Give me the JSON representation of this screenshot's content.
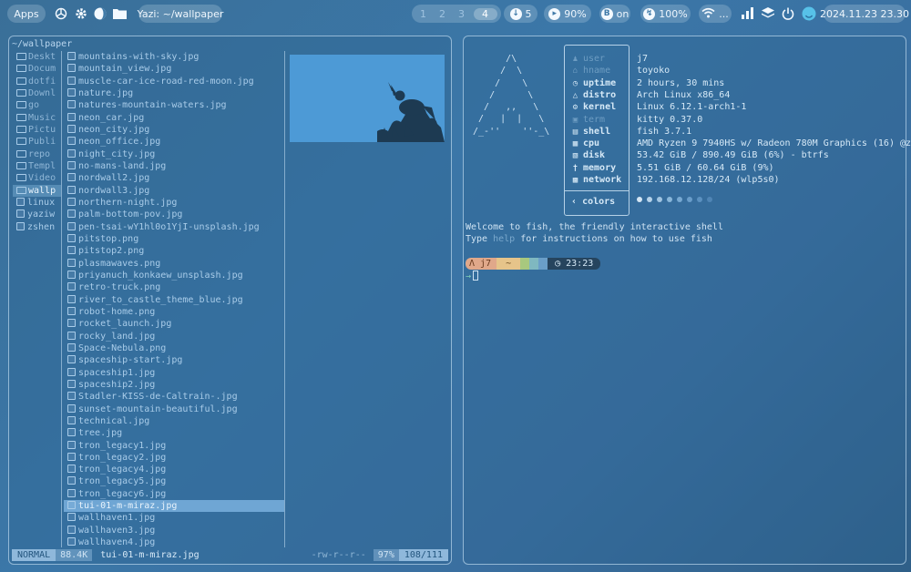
{
  "topbar": {
    "apps_label": "Apps",
    "window_title": "Yazi: ~/wallpaper",
    "workspaces": [
      "1",
      "2",
      "3",
      "4"
    ],
    "active_workspace": "4",
    "downloads_count": "5",
    "volume": "90%",
    "bluetooth": "on",
    "battery": "100%",
    "wifi_ellipsis": "...",
    "datetime": "2024.11.23 23.30"
  },
  "yazi": {
    "path": "~/wallpaper",
    "parent_items": [
      "Deskt",
      "Docum",
      "dotfi",
      "Downl",
      "go",
      "Music",
      "Pictu",
      "Publi",
      "repo",
      "Templ",
      "Video",
      "wallp",
      "linux",
      "yaziw",
      "zshen"
    ],
    "files": [
      "mountains-with-sky.jpg",
      "mountain_view.jpg",
      "muscle-car-ice-road-red-moon.jpg",
      "nature.jpg",
      "natures-mountain-waters.jpg",
      "neon_car.jpg",
      "neon_city.jpg",
      "neon_office.jpg",
      "night_city.jpg",
      "no-mans-land.jpg",
      "nordwall2.jpg",
      "nordwall3.jpg",
      "northern-night.jpg",
      "palm-bottom-pov.jpg",
      "pen-tsai-wY1hl0o1YjI-unsplash.jpg",
      "pitstop.png",
      "pitstop2.png",
      "plasmawaves.png",
      "priyanuch_konkaew_unsplash.jpg",
      "retro-truck.png",
      "river_to_castle_theme_blue.jpg",
      "robot-home.png",
      "rocket_launch.jpg",
      "rocky_land.jpg",
      "Space-Nebula.png",
      "spaceship-start.jpg",
      "spaceship1.jpg",
      "spaceship2.jpg",
      "Stadler-KISS-de-Caltrain-.jpg",
      "sunset-mountain-beautiful.jpg",
      "technical.jpg",
      "tree.jpg",
      "tron_legacy1.jpg",
      "tron_legacy2.jpg",
      "tron_legacy4.jpg",
      "tron_legacy5.jpg",
      "tron_legacy6.jpg",
      "tui-01-m-miraz.jpg",
      "wallhaven1.jpg",
      "wallhaven3.jpg",
      "wallhaven4.jpg"
    ],
    "selected_file": "tui-01-m-miraz.jpg",
    "status": {
      "mode": "NORMAL",
      "size": "88.4K",
      "name": "tui-01-m-miraz.jpg",
      "permissions": "-rw-r--r--",
      "percent": "97%",
      "position": "108/111"
    }
  },
  "terminal": {
    "ascii_logo": "       /\\\n      /  \\\n     /    \\\n    /      \\\n   /   ,,   \\\n  /   |  |   \\\n /_-''    ''-_\\",
    "fetch": [
      {
        "key": "user",
        "value": "j7",
        "dim": true
      },
      {
        "key": "hname",
        "value": "toyoko",
        "dim": true
      },
      {
        "key": "uptime",
        "value": "2 hours, 30 mins"
      },
      {
        "key": "distro",
        "value": "Arch Linux x86_64"
      },
      {
        "key": "kernel",
        "value": "Linux 6.12.1-arch1-1"
      },
      {
        "key": "term",
        "value": "kitty 0.37.0",
        "dim": true
      },
      {
        "key": "shell",
        "value": "fish 3.7.1"
      },
      {
        "key": "cpu",
        "value": "AMD Ryzen 9 7940HS w/ Radeon 780M Graphics (16) @z"
      },
      {
        "key": "disk",
        "value": "53.42 GiB / 890.49 GiB (6%) - btrfs"
      },
      {
        "key": "memory",
        "value": "5.51 GiB / 60.64 GiB (9%)"
      },
      {
        "key": "network",
        "value": "192.168.12.128/24 (wlp5s0)"
      }
    ],
    "colors_label": "colors",
    "color_dots": [
      "#d5e6f4",
      "#b7d3ea",
      "#a2c5e2",
      "#8ab7da",
      "#78a9d2",
      "#6a9dca",
      "#5c91c0",
      "#5085b5"
    ],
    "welcome_line": "Welcome to fish, the friendly interactive shell",
    "help_prefix": "Type ",
    "help_word": "help",
    "help_suffix": " for instructions on how to use fish",
    "prompt_user": "j7",
    "prompt_dir": "~",
    "prompt_time": "23:23",
    "prompt_arrow": "→"
  }
}
